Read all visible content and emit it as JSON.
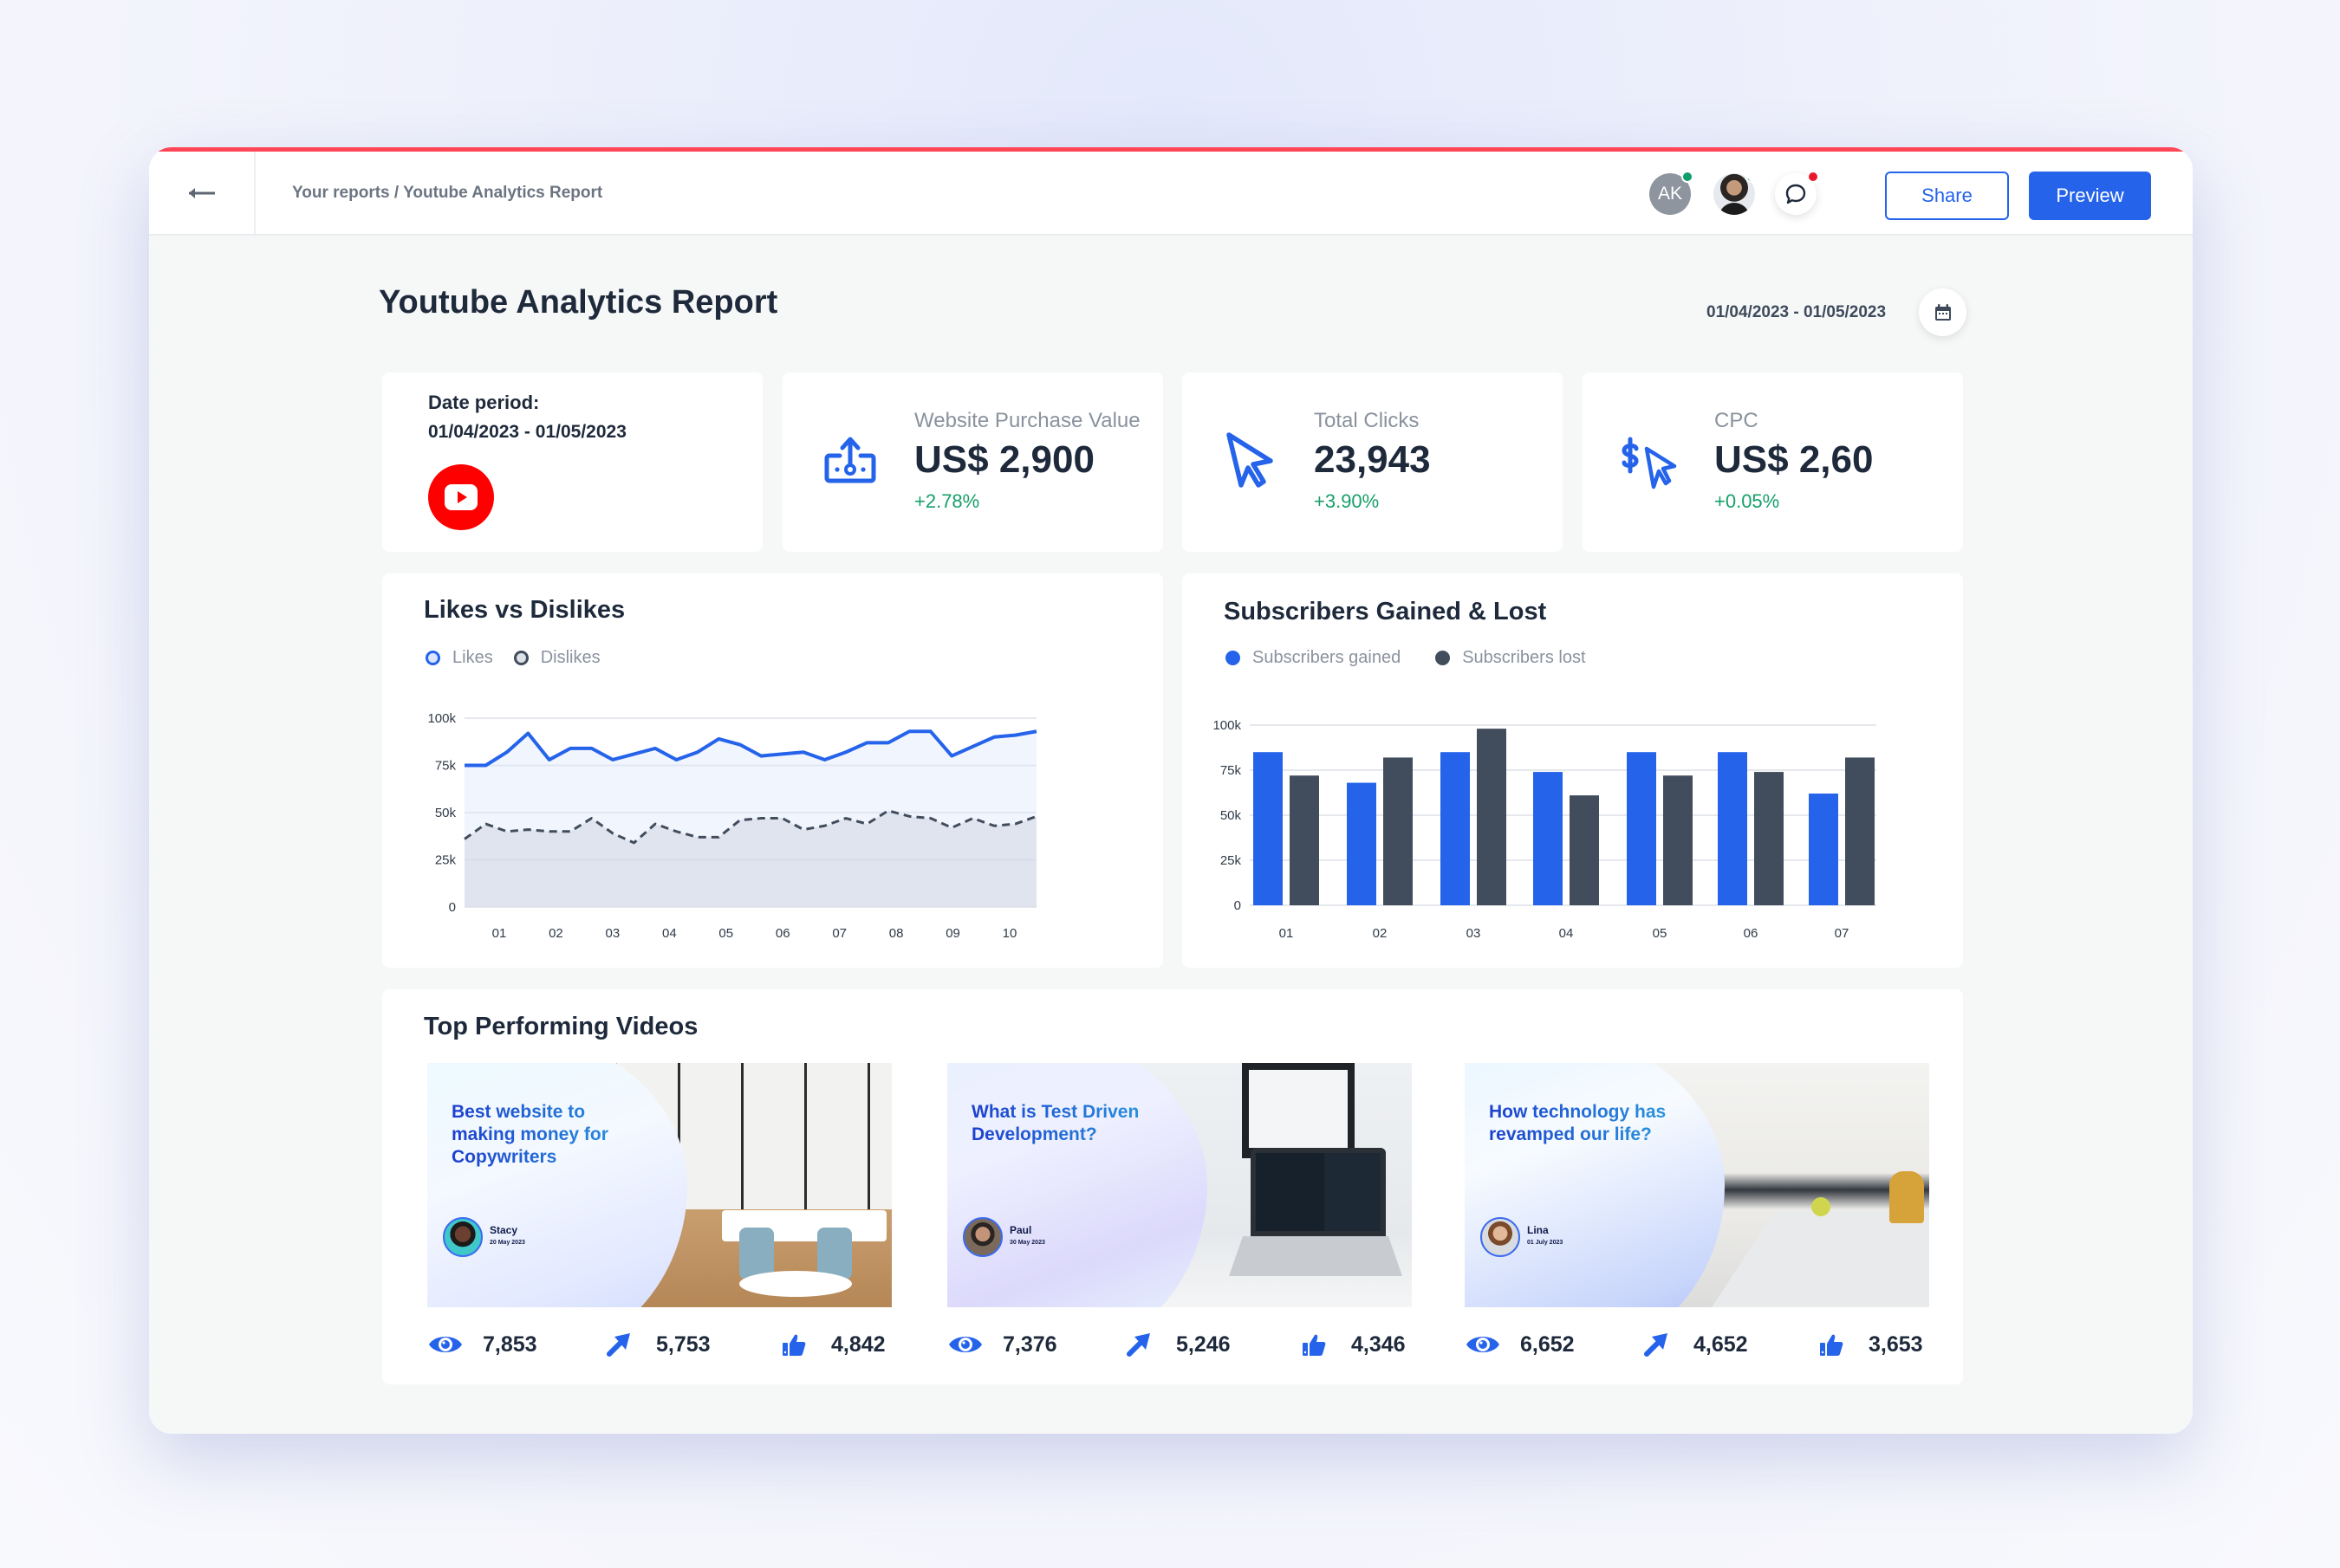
{
  "header": {
    "back_icon": "arrow-left-icon",
    "breadcrumb": "Your reports / Youtube Analytics Report",
    "avatars": [
      {
        "initials": "AK",
        "status": "online"
      },
      {
        "initials": "",
        "status": "online"
      }
    ],
    "messages_icon": "chat-bubble-icon",
    "messages_unread": true,
    "share_label": "Share",
    "preview_label": "Preview"
  },
  "page": {
    "title": "Youtube Analytics Report",
    "date_range": "01/04/2023 - 01/05/2023",
    "calendar_icon": "calendar-icon"
  },
  "kpis": {
    "date_card": {
      "label": "Date period:",
      "value": "01/04/2023 - 01/05/2023",
      "logo": "youtube-logo-icon"
    },
    "items": [
      {
        "label": "Website Purchase Value",
        "value": "US$ 2,900",
        "delta": "+2.78%",
        "icon": "money-upload-icon"
      },
      {
        "label": "Total Clicks",
        "value": "23,943",
        "delta": "+3.90%",
        "icon": "cursor-icon"
      },
      {
        "label": "CPC",
        "value": "US$ 2,60",
        "delta": "+0.05%",
        "icon": "dollar-cursor-icon"
      }
    ]
  },
  "colors": {
    "accent": "#2563eb",
    "dark_series": "#414d5c",
    "positive": "#16a06a",
    "topline": "#ff4656",
    "youtube": "#ff0000"
  },
  "chart_data": [
    {
      "type": "area",
      "title": "Likes vs Dislikes",
      "xlabel": "",
      "ylabel": "",
      "x_ticks": [
        "01",
        "02",
        "03",
        "04",
        "05",
        "06",
        "07",
        "08",
        "09",
        "10"
      ],
      "y_ticks": [
        "0",
        "25k",
        "50k",
        "75k",
        "100k"
      ],
      "ylim": [
        0,
        100000
      ],
      "grid": true,
      "legend": "top-left",
      "series": [
        {
          "name": "Likes",
          "style": "solid",
          "values": [
            75000,
            75000,
            82000,
            92000,
            78000,
            84000,
            84000,
            78000,
            81000,
            84000,
            78000,
            82000,
            89000,
            86000,
            80000,
            81000,
            82000,
            78000,
            82000,
            87000,
            87000,
            93000,
            93000,
            80000,
            85000,
            90000,
            91000,
            93000
          ]
        },
        {
          "name": "Dislikes",
          "style": "dashed",
          "values": [
            36000,
            44000,
            40000,
            41000,
            40000,
            40000,
            47000,
            39000,
            34000,
            44000,
            40000,
            37000,
            37000,
            46000,
            47000,
            47000,
            41000,
            43000,
            47000,
            44000,
            51000,
            48000,
            47000,
            42000,
            47000,
            43000,
            44000,
            48000
          ]
        }
      ]
    },
    {
      "type": "bar",
      "title": "Subscribers Gained & Lost",
      "xlabel": "",
      "ylabel": "",
      "categories": [
        "01",
        "02",
        "03",
        "04",
        "05",
        "06",
        "07"
      ],
      "y_ticks": [
        "0",
        "25k",
        "50k",
        "75k",
        "100k"
      ],
      "ylim": [
        0,
        100000
      ],
      "grid": true,
      "legend": "top-left",
      "series": [
        {
          "name": "Subscribers gained",
          "values": [
            85000,
            68000,
            85000,
            74000,
            85000,
            85000,
            62000
          ]
        },
        {
          "name": "Subscribers lost",
          "values": [
            72000,
            82000,
            98000,
            61000,
            72000,
            74000,
            82000
          ]
        }
      ]
    }
  ],
  "videos": {
    "title": "Top Performing Videos",
    "items": [
      {
        "title": "Best website to making money for Copywriters",
        "author": "Stacy",
        "date": "20 May 2023",
        "views": "7,853",
        "shares": "5,753",
        "likes": "4,842"
      },
      {
        "title": "What is Test Driven Development?",
        "author": "Paul",
        "date": "30 May 2023",
        "views": "7,376",
        "shares": "5,246",
        "likes": "4,346"
      },
      {
        "title": "How technology has revamped our life?",
        "author": "Lina",
        "date": "01 July 2023",
        "views": "6,652",
        "shares": "4,652",
        "likes": "3,653"
      }
    ],
    "stat_icons": [
      "eye-icon",
      "share-arrow-icon",
      "thumbs-up-icon"
    ]
  }
}
